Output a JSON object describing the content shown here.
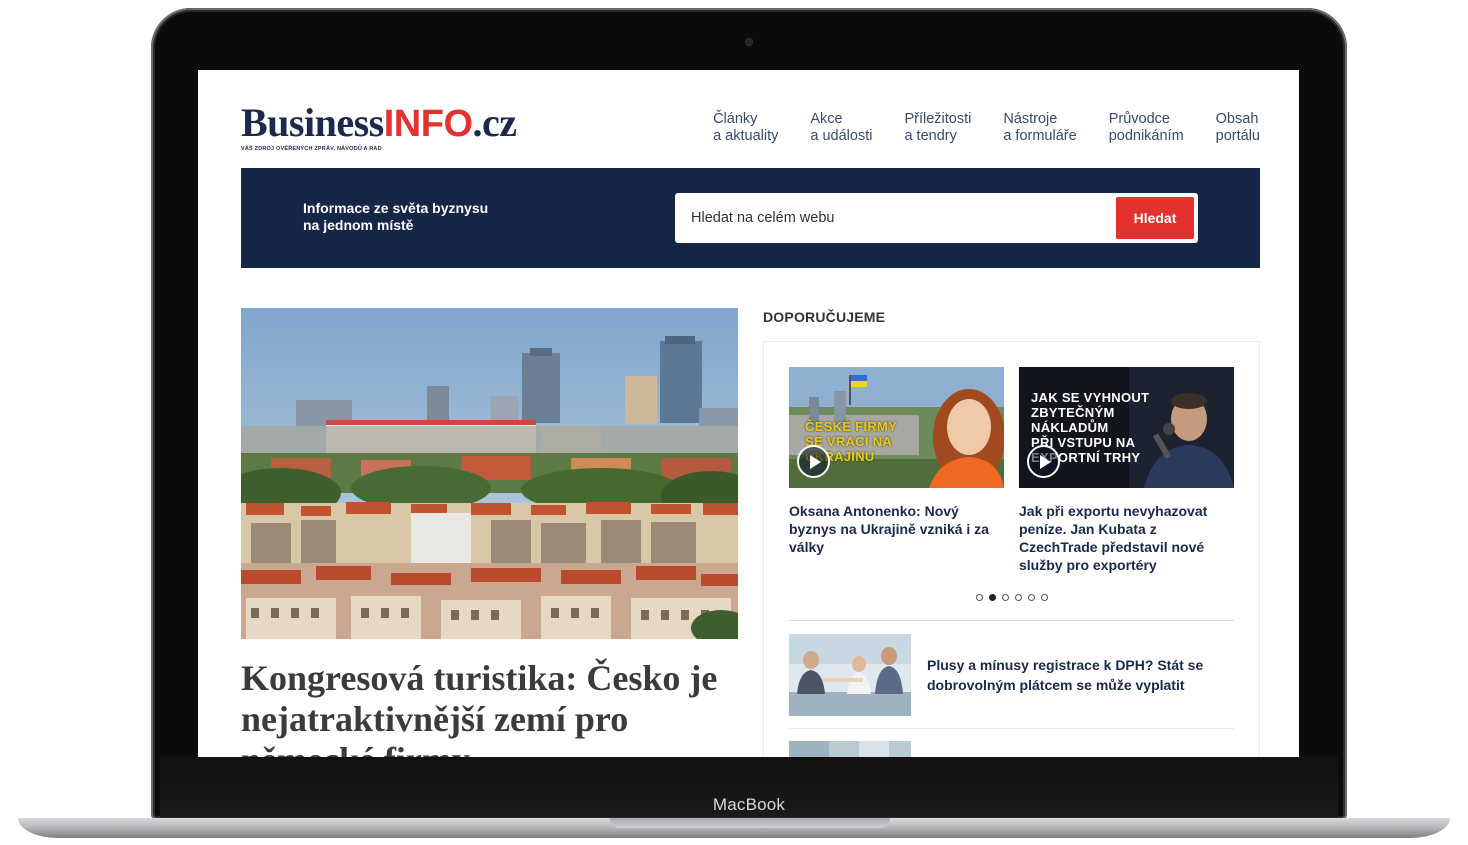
{
  "device": {
    "label": "MacBook"
  },
  "header": {
    "logo": {
      "business": "Business",
      "info": "INFO",
      "cz": ".cz",
      "tagline": "VÁŠ ZDROJ OVĚŘENÝCH ZPRÁV, NÁVODŮ A RAD"
    },
    "nav": [
      {
        "line1": "Články",
        "line2": "a aktuality"
      },
      {
        "line1": "Akce",
        "line2": "a události"
      },
      {
        "line1": "Příležitosti",
        "line2": "a tendry"
      },
      {
        "line1": "Nástroje",
        "line2": "a formuláře"
      },
      {
        "line1": "Průvodce",
        "line2": "podnikáním"
      },
      {
        "line1": "Obsah",
        "line2": "portálu"
      }
    ]
  },
  "banner": {
    "line1": "Informace ze světa byznysu",
    "line2": "na jednom místě",
    "search_placeholder": "Hledat na celém webu",
    "search_button": "Hledat"
  },
  "hero": {
    "title": "Kongresová turistika: Česko je nejatraktivnější zemí pro německé firmy"
  },
  "recommended": {
    "section_title": "DOPORUČUJEME",
    "cards": [
      {
        "thumb_lines": [
          "ČESKÉ FIRMY",
          "SE VRACÍ NA",
          "UKRAJINU"
        ],
        "title": "Oksana Antonenko: Nový byznys na Ukrajině vzniká i za války"
      },
      {
        "thumb_lines": [
          "JAK SE VYHNOUT",
          "ZBYTEČNÝM",
          "NÁKLADŮM",
          "PŘI VSTUPU NA",
          "EXPORTNÍ TRHY"
        ],
        "title": "Jak při exportu nevyhazovat peníze. Jan Kubata z CzechTrade představil nové služby pro exportéry"
      }
    ],
    "carousel": {
      "count": 6,
      "active": 2
    },
    "list": [
      {
        "title": "Plusy a mínusy registrace k DPH? Stát se dobrovolným plátcem se může vyplatit"
      }
    ]
  }
}
